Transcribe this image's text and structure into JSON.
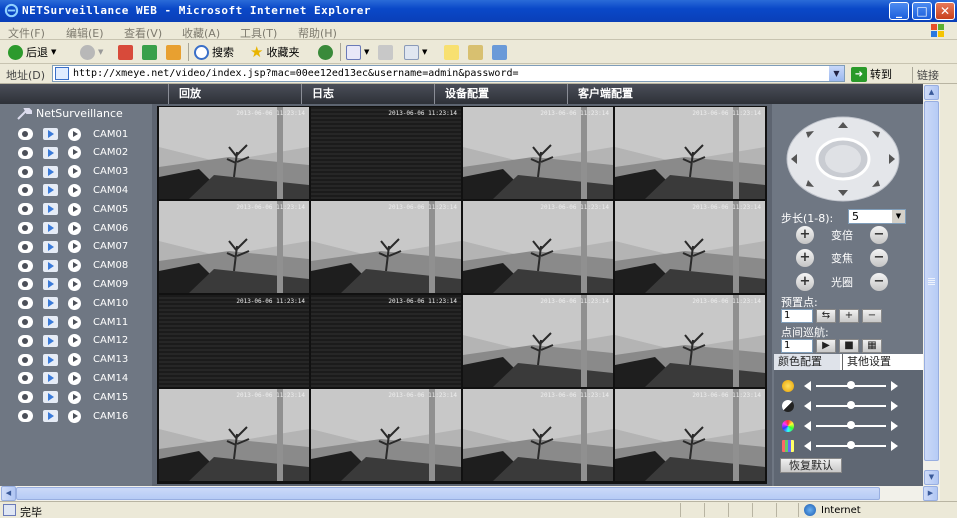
{
  "window": {
    "title": "NETSurveillance WEB - Microsoft Internet Explorer",
    "buttons": [
      "_",
      "□",
      "✕"
    ]
  },
  "menubar": {
    "items": [
      "文件(F)",
      "编辑(E)",
      "查看(V)",
      "收藏(A)",
      "工具(T)",
      "帮助(H)"
    ]
  },
  "toolbar": {
    "back_label": "后退",
    "search_label": "搜索",
    "favorites_label": "收藏夹"
  },
  "addressbar": {
    "label": "地址(D)",
    "url": "http://xmeye.net/video/index.jsp?mac=00ee12ed13ec&username=admin&password=",
    "go_label": "转到",
    "links_label": "链接"
  },
  "app": {
    "nav": [
      "回放",
      "日志",
      "设备配置",
      "客户端配置"
    ],
    "brand": "NetSurveillance",
    "cameras": [
      "CAM01",
      "CAM02",
      "CAM03",
      "CAM04",
      "CAM05",
      "CAM06",
      "CAM07",
      "CAM08",
      "CAM09",
      "CAM10",
      "CAM11",
      "CAM12",
      "CAM13",
      "CAM14",
      "CAM15",
      "CAM16"
    ],
    "video_tiles": [
      {
        "state": "live",
        "stamp": "2013-06-06 11:23:14"
      },
      {
        "state": "dark",
        "stamp": "2013-06-06 11:23:14"
      },
      {
        "state": "live",
        "stamp": "2013-06-06 11:23:14"
      },
      {
        "state": "live",
        "stamp": "2013-06-06 11:23:14"
      },
      {
        "state": "live",
        "stamp": "2013-06-06 11:23:14"
      },
      {
        "state": "live",
        "stamp": "2013-06-06 11:23:14"
      },
      {
        "state": "live",
        "stamp": "2013-06-06 11:23:14",
        "selected": true
      },
      {
        "state": "live",
        "stamp": "2013-06-06 11:23:14"
      },
      {
        "state": "dark",
        "stamp": "2013-06-06 11:23:14"
      },
      {
        "state": "dark",
        "stamp": "2013-06-06 11:23:14"
      },
      {
        "state": "live",
        "stamp": "2013-06-06 11:23:14"
      },
      {
        "state": "live",
        "stamp": "2013-06-06 11:23:14"
      },
      {
        "state": "live",
        "stamp": "2013-06-06 11:23:14"
      },
      {
        "state": "live",
        "stamp": "2013-06-06 11:23:14"
      },
      {
        "state": "live",
        "stamp": "2013-06-06 11:23:14"
      },
      {
        "state": "live",
        "stamp": "2013-06-06 11:23:14"
      }
    ],
    "ptz": {
      "step_label": "步长(1-8):",
      "step_value": "5",
      "zoom_label": "变倍",
      "focus_label": "变焦",
      "iris_label": "光圈",
      "preset_label": "预置点:",
      "preset_value": "1",
      "cruise_label": "点间巡航:",
      "cruise_value": "1"
    },
    "tabs": [
      "颜色配置",
      "其他设置"
    ],
    "color_sliders": [
      {
        "name": "brightness",
        "value": 0.5
      },
      {
        "name": "contrast",
        "value": 0.5
      },
      {
        "name": "saturation",
        "value": 0.5
      },
      {
        "name": "hue",
        "value": 0.5
      }
    ],
    "reset_label": "恢复默认"
  },
  "statusbar": {
    "status": "完毕",
    "zone": "Internet"
  }
}
